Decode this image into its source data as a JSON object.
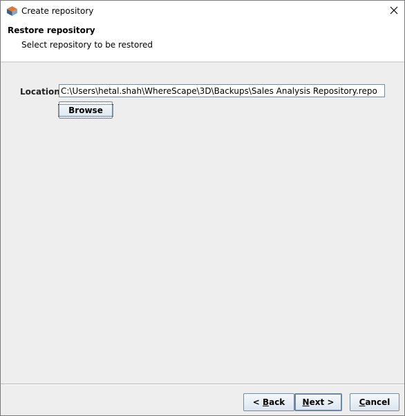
{
  "window": {
    "title": "Create repository",
    "close_glyph": "✕"
  },
  "header": {
    "title": "Restore repository",
    "subtitle": "Select repository to be restored"
  },
  "form": {
    "location_label": "Location:",
    "location_value": "C:\\Users\\hetal.shah\\WhereScape\\3D\\Backups\\Sales Analysis Repository.repo",
    "browse_label": "Browse"
  },
  "footer": {
    "back_prefix": "< ",
    "back_mnemonic": "B",
    "back_rest": "ack",
    "next_mnemonic": "N",
    "next_rest": "ext >",
    "cancel_mnemonic": "C",
    "cancel_rest": "ancel"
  },
  "icons": {
    "app": "app-logo-icon",
    "close": "close-icon"
  },
  "colors": {
    "content_bg": "#eeeeee",
    "button_border": "#7a8a99",
    "default_button_border": "#6d86a4"
  }
}
